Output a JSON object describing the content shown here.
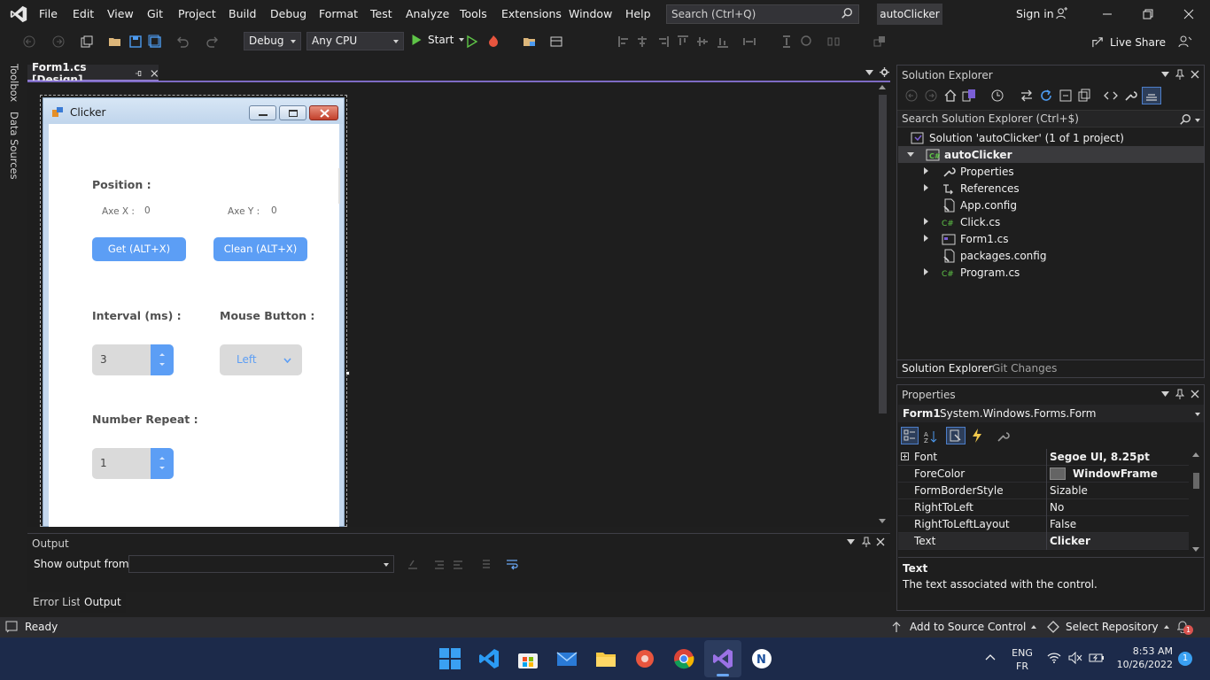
{
  "menu": {
    "items": [
      "File",
      "Edit",
      "View",
      "Git",
      "Project",
      "Build",
      "Debug",
      "Format",
      "Test",
      "Analyze",
      "Tools",
      "Extensions",
      "Window",
      "Help"
    ],
    "search_placeholder": "Search (Ctrl+Q)",
    "solution_name": "autoClicker",
    "sign_in": "Sign in"
  },
  "toolbar": {
    "config": "Debug",
    "platform": "Any CPU",
    "start": "Start",
    "live_share": "Live Share"
  },
  "side_tabs": [
    "Toolbox",
    "Data Sources"
  ],
  "document_tab": {
    "label": "Form1.cs [Design]"
  },
  "form": {
    "title": "Clicker",
    "position_label": "Position :",
    "axe_x_label": "Axe X :",
    "axe_x_value": "0",
    "axe_y_label": "Axe Y :",
    "axe_y_value": "0",
    "get_button": "Get (ALT+X)",
    "clean_button": "Clean (ALT+X)",
    "interval_label": "Interval (ms) :",
    "interval_value": "3",
    "mouse_button_label": "Mouse Button :",
    "mouse_button_value": "Left",
    "number_repeat_label": "Number Repeat :",
    "number_repeat_value": "1"
  },
  "output": {
    "title": "Output",
    "show_from_label": "Show output from:",
    "bottom_tabs": [
      "Error List",
      "Output"
    ]
  },
  "solution_explorer": {
    "title": "Solution Explorer",
    "search_placeholder": "Search Solution Explorer (Ctrl+$)",
    "solution": "Solution 'autoClicker' (1 of 1 project)",
    "project": "autoClicker",
    "items": [
      "Properties",
      "References",
      "App.config",
      "Click.cs",
      "Form1.cs",
      "packages.config",
      "Program.cs"
    ],
    "bottom_tabs": [
      "Solution Explorer",
      "Git Changes"
    ]
  },
  "properties": {
    "title": "Properties",
    "object": "Form1",
    "object_type": "System.Windows.Forms.Form",
    "rows": [
      {
        "name": "Font",
        "value": "Segoe UI, 8.25pt"
      },
      {
        "name": "ForeColor",
        "value": "WindowFrame"
      },
      {
        "name": "FormBorderStyle",
        "value": "Sizable"
      },
      {
        "name": "RightToLeft",
        "value": "No"
      },
      {
        "name": "RightToLeftLayout",
        "value": "False"
      },
      {
        "name": "Text",
        "value": "Clicker"
      }
    ],
    "desc_title": "Text",
    "desc_text": "The text associated with the control."
  },
  "status": {
    "ready": "Ready",
    "add_source": "Add to Source Control",
    "select_repo": "Select Repository",
    "notifications": "1"
  },
  "taskbar": {
    "lang_top": "ENG",
    "lang_bottom": "FR",
    "time": "8:53 AM",
    "date": "10/26/2022",
    "notif_count": "1"
  },
  "colors": {
    "accent": "#7e6bc4",
    "form_button_blue": "#5c9ef5",
    "taskbar": "#1c2a4a"
  }
}
